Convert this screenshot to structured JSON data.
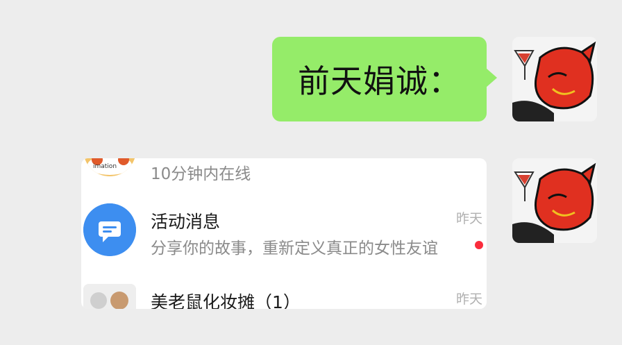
{
  "chat": {
    "message_text": "前天娟诚：",
    "bubble_color": "#95ec69"
  },
  "screenshot_card": {
    "rows": [
      {
        "title": "",
        "subtitle": "10分钟内在线",
        "time": "",
        "icon": "cartoon-avatar"
      },
      {
        "title": "活动消息",
        "subtitle": "分享你的故事，重新定义真正的女性友谊",
        "time": "昨天",
        "icon": "message-bubble-icon",
        "unread": true
      },
      {
        "title": "美老鼠化妆摊（1）",
        "subtitle": "",
        "time": "昨天",
        "icon": "group-avatar"
      }
    ],
    "accent_blue": "#3d8ef0",
    "unread_color": "#fa2c3c"
  },
  "avatars": {
    "sender_avatar_icon": "red-devil-cartoon-avatar"
  }
}
